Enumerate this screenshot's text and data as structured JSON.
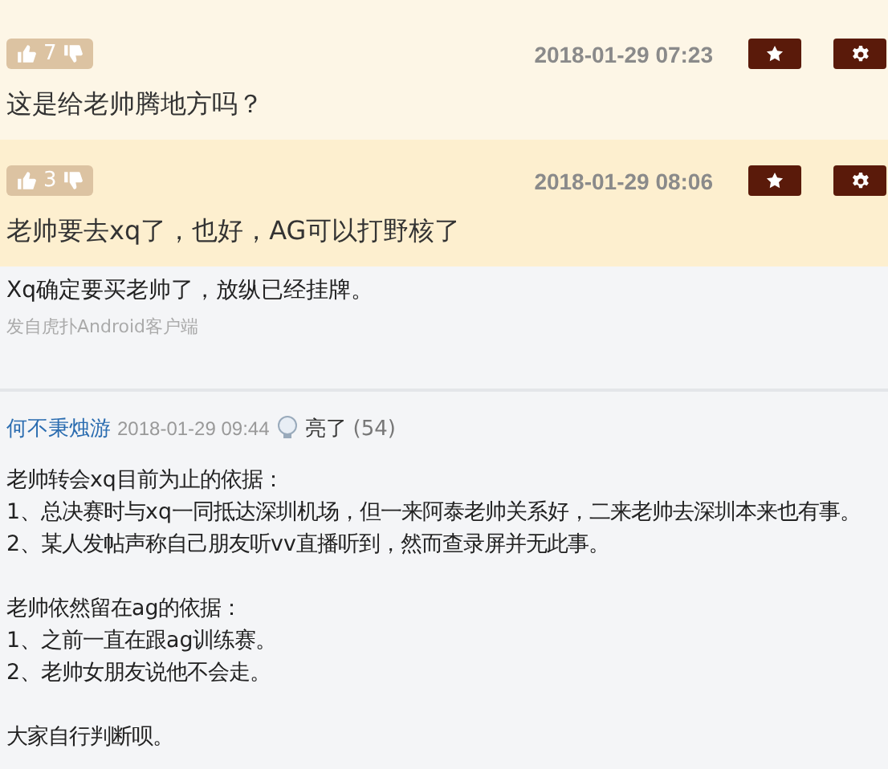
{
  "comments": [
    {
      "likes": "7",
      "time": "2018-01-29 07:23",
      "text": "这是给老帅腾地方吗？",
      "highlighted": false
    },
    {
      "likes": "3",
      "time": "2018-01-29 08:06",
      "text": "老帅要去xq了，也好，AG可以打野核了",
      "highlighted": true
    }
  ],
  "post": {
    "text": "Xq确定要买老帅了，放纵已经挂牌。",
    "source": "发自虎扑Android客户端"
  },
  "reply": {
    "author": "何不秉烛游",
    "time": "2018-01-29 09:44",
    "light_label": "亮了",
    "light_count": "(54)",
    "paragraphs": [
      [
        "老帅转会xq目前为止的依据：",
        "1、总决赛时与xq一同抵达深圳机场，但一来阿泰老帅关系好，二来老帅去深圳本来也有事。",
        "2、某人发帖声称自己朋友听vv直播听到，然而查录屏并无此事。"
      ],
      [
        "老帅依然留在ag的依据：",
        "1、之前一直在跟ag训练赛。",
        "2、老帅女朋友说他不会走。"
      ],
      [
        "大家自行判断呗。"
      ]
    ]
  }
}
